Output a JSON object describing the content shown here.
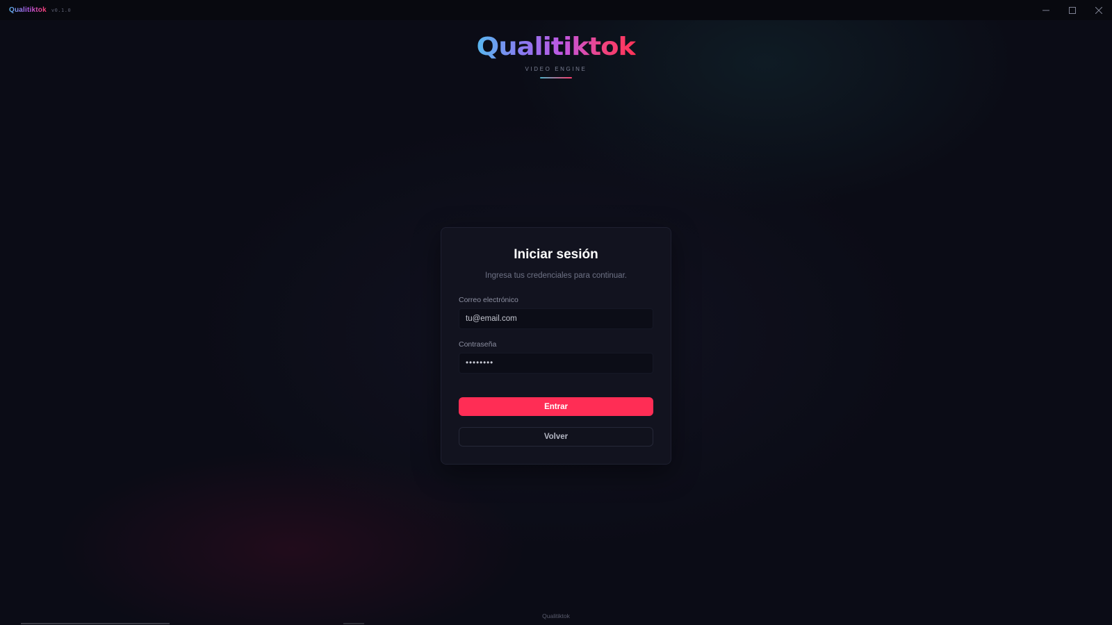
{
  "window": {
    "app_name": "Qualitiktok",
    "version": "v0.1.0",
    "controls": {
      "minimize_icon": "minimize-icon",
      "maximize_icon": "maximize-icon",
      "close_icon": "close-icon"
    }
  },
  "logo": {
    "title": "Qualitiktok",
    "subtitle": "VIDEO ENGINE"
  },
  "login": {
    "title": "Iniciar sesión",
    "subtitle": "Ingresa tus credenciales para continuar.",
    "email_label": "Correo electrónico",
    "email_placeholder": "tu@email.com",
    "email_value": "",
    "password_label": "Contraseña",
    "password_value": "••••••••",
    "submit_label": "Entrar",
    "back_label": "Volver"
  },
  "footer": {
    "text": "Qualitiktok"
  },
  "colors": {
    "accent": "#ff2d55",
    "background": "#0b0c16",
    "card": "#12131f",
    "logo_gradient_start": "#58b8ef",
    "logo_gradient_end": "#ff3358"
  }
}
